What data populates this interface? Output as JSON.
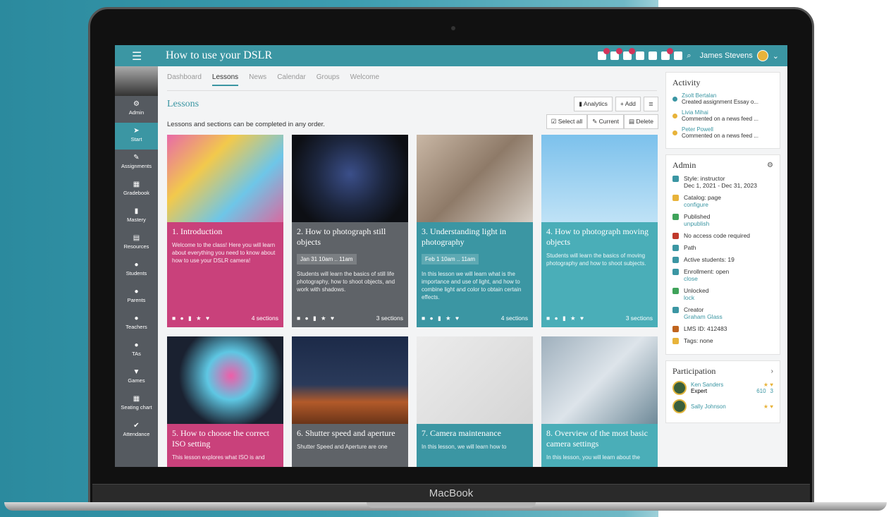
{
  "app": {
    "title": "How to use your DSLR",
    "user": "James Stevens",
    "brand": "MacBook"
  },
  "tabs": [
    "Dashboard",
    "Lessons",
    "News",
    "Calendar",
    "Groups",
    "Welcome"
  ],
  "sidebar": [
    {
      "label": "Admin",
      "icon": "gear-icon"
    },
    {
      "label": "Start",
      "icon": "arrow-icon"
    },
    {
      "label": "Assignments",
      "icon": "edit-icon"
    },
    {
      "label": "Gradebook",
      "icon": "grid-icon"
    },
    {
      "label": "Mastery",
      "icon": "bars-icon"
    },
    {
      "label": "Resources",
      "icon": "book-icon"
    },
    {
      "label": "Students",
      "icon": "person-icon"
    },
    {
      "label": "Parents",
      "icon": "person-icon"
    },
    {
      "label": "Teachers",
      "icon": "person-icon"
    },
    {
      "label": "TAs",
      "icon": "person-icon"
    },
    {
      "label": "Games",
      "icon": "trophy-icon"
    },
    {
      "label": "Seating chart",
      "icon": "grid-icon"
    },
    {
      "label": "Attendance",
      "icon": "check-icon"
    }
  ],
  "lessons": {
    "heading": "Lessons",
    "subtitle": "Lessons and sections can be completed in any order.",
    "analytics": "Analytics",
    "add": "+ Add",
    "select_all": "Select all",
    "current": "Current",
    "delete": "Delete"
  },
  "cards": [
    {
      "title": "1. Introduction",
      "date": "",
      "desc": "Welcome to the class! Here you will learn about everything you need to know about how to use your DSLR camera!",
      "sections": "4 sections",
      "color": "#c9417b"
    },
    {
      "title": "2. How to photograph still objects",
      "date": "Jan 31 10am .. 11am",
      "desc": "Students will learn the basics of still life photography, how to shoot objects, and work with shadows.",
      "sections": "3 sections",
      "color": "#5f6368"
    },
    {
      "title": "3. Understanding light in photography",
      "date": "Feb 1 10am .. 11am",
      "desc": "In this lesson we will learn what is the importance and use of light, and how to combine light and color to obtain certain effects.",
      "sections": "4 sections",
      "color": "#3b96a3"
    },
    {
      "title": "4. How to photograph moving objects",
      "date": "",
      "desc": "Students will learn the basics of moving photography and how to shoot subjects.",
      "sections": "3 sections",
      "color": "#4aaeb8"
    },
    {
      "title": "5. How to choose the correct ISO setting",
      "date": "",
      "desc": "This lesson explores what ISO is and",
      "sections": "",
      "color": "#c9417b"
    },
    {
      "title": "6. Shutter speed and aperture",
      "date": "",
      "desc": "Shutter Speed and Aperture are one",
      "sections": "",
      "color": "#5f6368"
    },
    {
      "title": "7. Camera maintenance",
      "date": "",
      "desc": "In this lesson, we will learn how to",
      "sections": "",
      "color": "#3b96a3"
    },
    {
      "title": "8. Overview of the most basic camera settings",
      "date": "",
      "desc": "In this lesson, you will learn about the",
      "sections": "",
      "color": "#4aaeb8"
    }
  ],
  "activity": {
    "title": "Activity",
    "items": [
      {
        "who": "Zsolt Bertalan",
        "what": "Created assignment Essay o..."
      },
      {
        "who": "Livia Mihai",
        "what": "Commented on a news feed ..."
      },
      {
        "who": "Peter Powell",
        "what": "Commented on a news feed ..."
      }
    ]
  },
  "admin": {
    "title": "Admin",
    "rows": [
      {
        "text": "Style: instructor",
        "sub": "Dec 1, 2021 - Dec 31, 2023",
        "link": ""
      },
      {
        "text": "Catalog: page",
        "sub": "",
        "link": "configure"
      },
      {
        "text": "Published",
        "sub": "",
        "link": "unpublish"
      },
      {
        "text": "No access code required",
        "sub": "",
        "link": ""
      },
      {
        "text": "Path",
        "sub": "",
        "link": ""
      },
      {
        "text": "Active students: 19",
        "sub": "",
        "link": ""
      },
      {
        "text": "Enrollment: open",
        "sub": "",
        "link": "close"
      },
      {
        "text": "Unlocked",
        "sub": "",
        "link": "lock"
      },
      {
        "text": "Creator",
        "sub": "",
        "link": "Graham Glass"
      },
      {
        "text": "LMS ID: 412483",
        "sub": "",
        "link": ""
      },
      {
        "text": "Tags: none",
        "sub": "",
        "link": ""
      }
    ]
  },
  "participation": {
    "title": "Participation",
    "rows": [
      {
        "name": "Ken Sanders",
        "level": "Expert",
        "points": "610",
        "stars": "3"
      },
      {
        "name": "Sally Johnson",
        "level": "",
        "points": "",
        "stars": ""
      }
    ]
  }
}
